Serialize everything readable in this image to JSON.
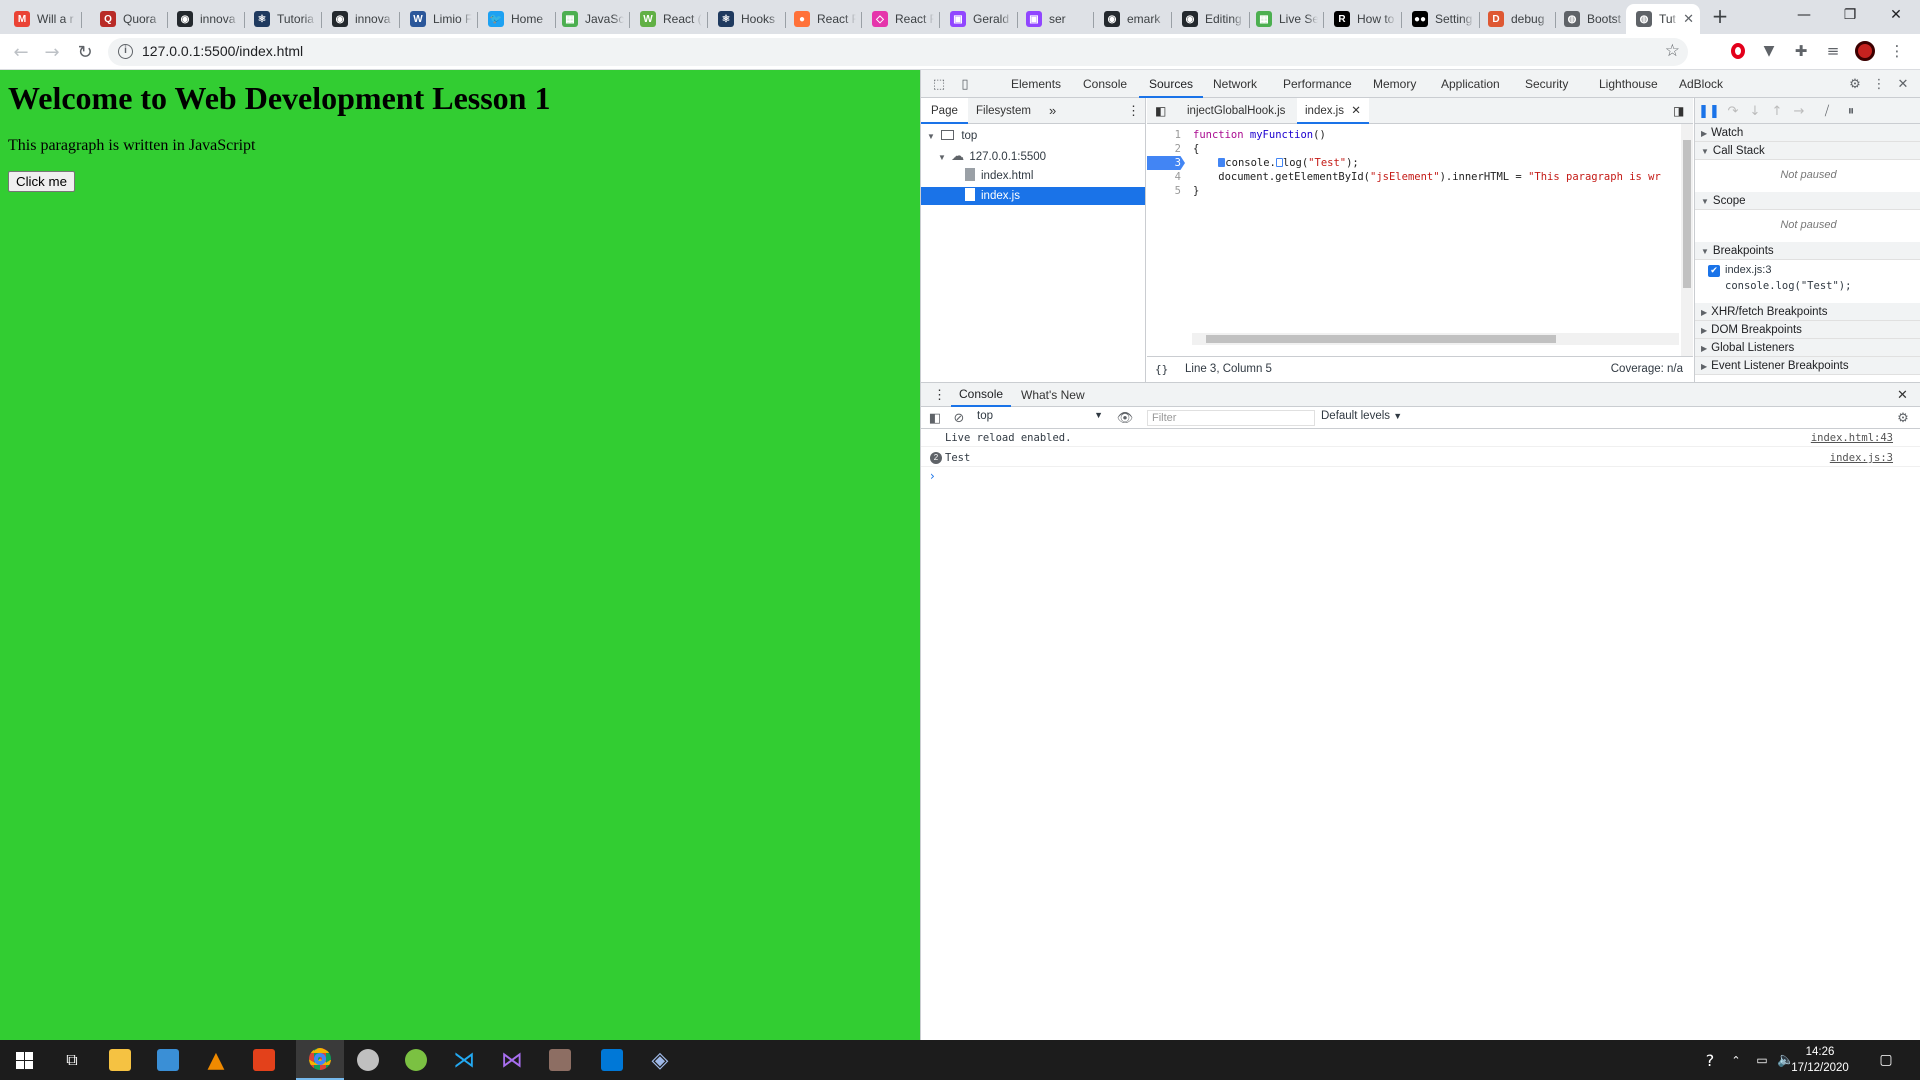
{
  "browser": {
    "tabs": [
      {
        "label": "Will a r",
        "icon": "gmail-icon",
        "color": "#ea4335",
        "glyph": "M"
      },
      {
        "label": "Quora",
        "icon": "quora-icon",
        "color": "#b92b27",
        "glyph": "Q"
      },
      {
        "label": "innova",
        "icon": "github-icon",
        "color": "#24292e",
        "glyph": "◉"
      },
      {
        "label": "Tutoria",
        "icon": "tutorial-icon",
        "color": "#1f3a5f",
        "glyph": "⚛"
      },
      {
        "label": "innova",
        "icon": "github-icon",
        "color": "#24292e",
        "glyph": "◉"
      },
      {
        "label": "Limio F",
        "icon": "word-icon",
        "color": "#2b579a",
        "glyph": "W"
      },
      {
        "label": "Home",
        "icon": "twitter-icon",
        "color": "#1da1f2",
        "glyph": "🐦"
      },
      {
        "label": "JavaSc",
        "icon": "w3schools-icon",
        "color": "#4caf50",
        "glyph": "▦"
      },
      {
        "label": "React (",
        "icon": "react-icon",
        "color": "#61b045",
        "glyph": "W"
      },
      {
        "label": "Hooks",
        "icon": "react-icon",
        "color": "#1f3a5f",
        "glyph": "⚛"
      },
      {
        "label": "React F",
        "icon": "firefox-icon",
        "color": "#ff7139",
        "glyph": "●"
      },
      {
        "label": "React F",
        "icon": "graphql-icon",
        "color": "#e535ab",
        "glyph": "◇"
      },
      {
        "label": "Gerald",
        "icon": "twitch-icon",
        "color": "#9146ff",
        "glyph": "▣"
      },
      {
        "label": "ser",
        "icon": "twitch-icon",
        "color": "#9146ff",
        "glyph": "▣"
      },
      {
        "label": "emark",
        "icon": "github-icon",
        "color": "#24292e",
        "glyph": "◉"
      },
      {
        "label": "Editing",
        "icon": "github-icon",
        "color": "#24292e",
        "glyph": "◉"
      },
      {
        "label": "Live Se",
        "icon": "w3schools-icon",
        "color": "#4caf50",
        "glyph": "▦"
      },
      {
        "label": "How to",
        "icon": "r-icon",
        "color": "#000000",
        "glyph": "R"
      },
      {
        "label": "Setting",
        "icon": "medium-icon",
        "color": "#000000",
        "glyph": "●●"
      },
      {
        "label": "debug",
        "icon": "duckduckgo-icon",
        "color": "#de5833",
        "glyph": "D"
      },
      {
        "label": "Bootst",
        "icon": "globe-icon",
        "color": "#5f6368",
        "glyph": "◍"
      },
      {
        "label": "Tut",
        "icon": "globe-icon",
        "color": "#5f6368",
        "glyph": "◍"
      }
    ],
    "url": "127.0.0.1:5500/index.html"
  },
  "page": {
    "heading": "Welcome to Web Development Lesson 1",
    "paragraph": "This paragraph is written in JavaScript",
    "button": "Click me",
    "background": "#32cd32"
  },
  "devtools": {
    "tabs": [
      "Elements",
      "Console",
      "Sources",
      "Network",
      "Performance",
      "Memory",
      "Application",
      "Security",
      "Lighthouse",
      "AdBlock"
    ],
    "active_tab": "Sources",
    "navigator": {
      "tabs": [
        "Page",
        "Filesystem"
      ],
      "top": "top",
      "origin": "127.0.0.1:5500",
      "files": [
        "index.html",
        "index.js"
      ]
    },
    "editor": {
      "tabs": [
        "injectGlobalHook.js",
        "index.js"
      ],
      "lines": [
        {
          "n": "1",
          "html": "<span class='kw'>function</span> <span class='fn'>myFunction</span>()"
        },
        {
          "n": "2",
          "html": "{"
        },
        {
          "n": "3",
          "html": "    <span class='marker'></span>console.<span class='marker2'></span>log(<span class='str'>\"Test\"</span>);"
        },
        {
          "n": "4",
          "html": "    document.getElementById(<span class='str'>\"jsElement\"</span>).innerHTML = <span class='str'>\"This paragraph is wr</span>"
        },
        {
          "n": "5",
          "html": "}"
        }
      ],
      "status": "Line 3, Column 5",
      "coverage": "Coverage: n/a"
    },
    "debugger": {
      "watch": "Watch",
      "call_stack": "Call Stack",
      "not_paused": "Not paused",
      "scope": "Scope",
      "breakpoints": "Breakpoints",
      "bp_file": "index.js:3",
      "bp_code": "console.log(\"Test\");",
      "xhr": "XHR/fetch Breakpoints",
      "dom": "DOM Breakpoints",
      "global": "Global Listeners",
      "event": "Event Listener Breakpoints"
    },
    "drawer": {
      "tabs": [
        "Console",
        "What's New"
      ],
      "context": "top",
      "filter_placeholder": "Filter",
      "levels": "Default levels",
      "messages": [
        {
          "text": "Live reload enabled.",
          "source": "index.html:43",
          "count": ""
        },
        {
          "text": "Test",
          "source": "index.js:3",
          "count": "2"
        }
      ]
    }
  },
  "taskbar": {
    "time": "14:26",
    "date": "17/12/2020"
  }
}
